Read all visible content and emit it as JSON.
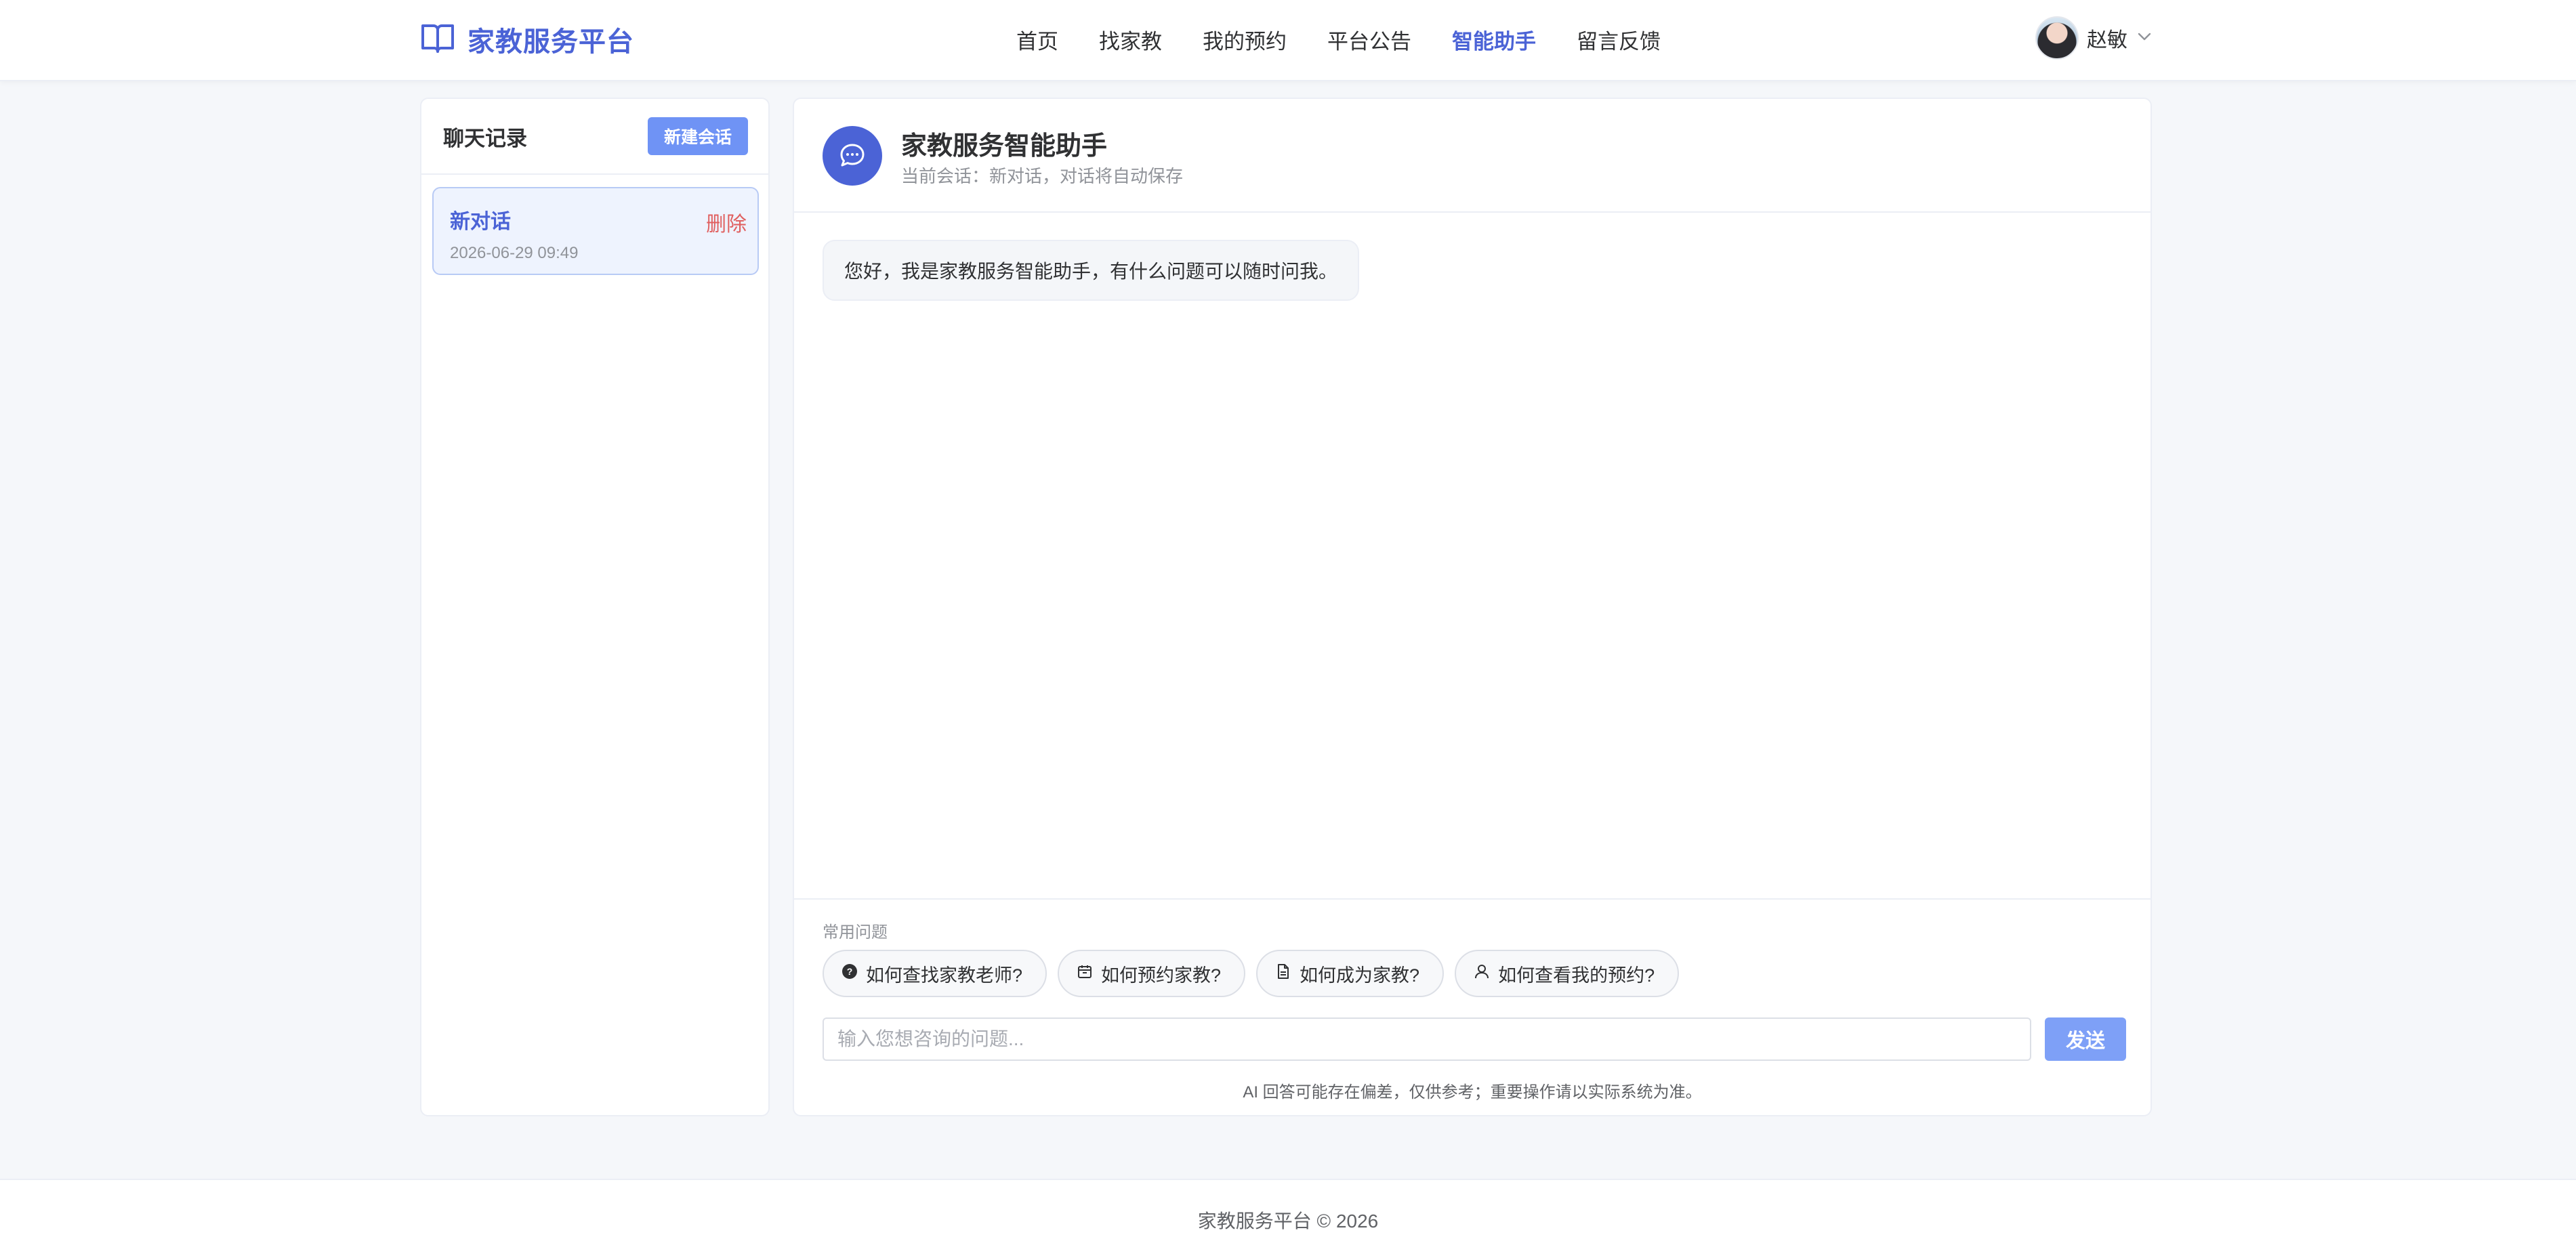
{
  "brand": {
    "name": "家教服务平台",
    "color": "#4b63d6"
  },
  "nav": {
    "items": [
      {
        "label": "首页",
        "active": false
      },
      {
        "label": "找家教",
        "active": false
      },
      {
        "label": "我的预约",
        "active": false
      },
      {
        "label": "平台公告",
        "active": false
      },
      {
        "label": "智能助手",
        "active": true
      },
      {
        "label": "留言反馈",
        "active": false
      }
    ]
  },
  "user": {
    "name": "赵敏",
    "avatar_icon": "user-avatar"
  },
  "history": {
    "title": "聊天记录",
    "new_button": "新建会话",
    "conversations": [
      {
        "name": "新对话",
        "time": "2026-06-29 09:49",
        "delete_label": "删除",
        "active": true
      }
    ]
  },
  "chat": {
    "title": "家教服务智能助手",
    "subtitle": "当前会话：新对话，对话将自动保存",
    "bot_icon": "chat-bubble-icon",
    "messages": [
      {
        "role": "assistant",
        "text": "您好，我是家教服务智能助手，有什么问题可以随时问我。"
      }
    ],
    "faq_label": "常用问题",
    "faq": [
      {
        "label": "如何查找家教老师?",
        "icon": "question-circle-icon"
      },
      {
        "label": "如何预约家教?",
        "icon": "calendar-icon"
      },
      {
        "label": "如何成为家教?",
        "icon": "document-icon"
      },
      {
        "label": "如何查看我的预约?",
        "icon": "user-icon"
      }
    ],
    "input_placeholder": "输入您想咨询的问题...",
    "input_value": "",
    "send_label": "发送",
    "disclaimer": "AI 回答可能存在偏差，仅供参考；重要操作请以实际系统为准。"
  },
  "footer": {
    "text": "家教服务平台 © 2026"
  },
  "colors": {
    "accent": "#4b63d6",
    "button": "#6f93f5",
    "danger": "#e06060",
    "background": "#f5f7fa"
  }
}
